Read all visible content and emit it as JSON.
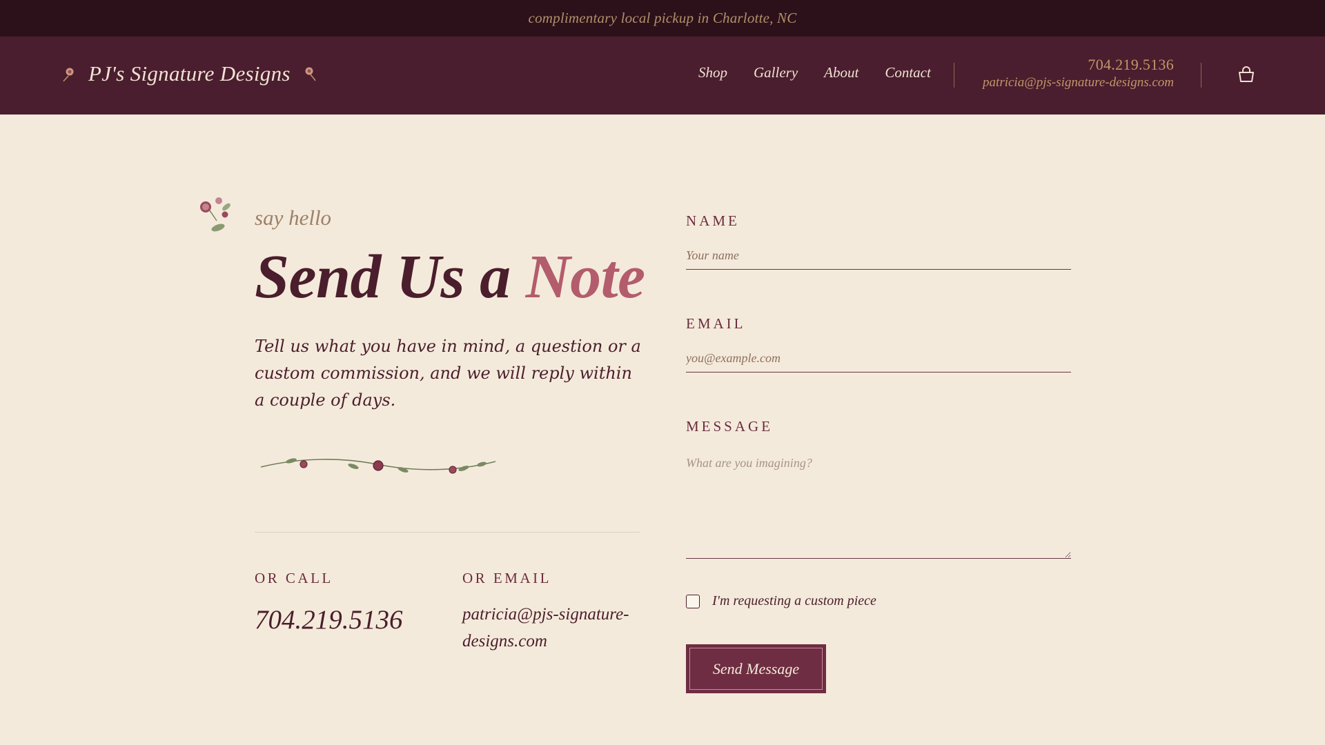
{
  "promo": {
    "text": "complimentary local pickup in Charlotte, NC"
  },
  "header": {
    "brand": "PJ's Signature Designs",
    "nav": [
      "Shop",
      "Gallery",
      "About",
      "Contact"
    ],
    "phone": "704.219.5136",
    "email": "patricia@pjs-signature-designs.com",
    "icons": [
      "flower-icon",
      "cart-icon"
    ]
  },
  "intro": {
    "eyebrow": "say hello",
    "headline_main": "Send Us a ",
    "headline_accent": "Note",
    "lede": "Tell us what you have in mind, a question or a custom commission, and we will reply within a couple of days."
  },
  "contact": {
    "call_label": "OR CALL",
    "phone": "704.219.5136",
    "email_label": "OR EMAIL",
    "email": "patricia@pjs-signature-designs.com"
  },
  "form": {
    "name_label": "NAME",
    "name_placeholder": "Your name",
    "email_label": "EMAIL",
    "email_placeholder": "you@example.com",
    "message_label": "MESSAGE",
    "message_placeholder": "What are you imagining?",
    "custom_label": "I'm requesting a custom piece",
    "custom_checked": false,
    "submit_label": "Send Message"
  },
  "colors": {
    "page_bg": "#f4eadb",
    "header_bg": "#4a1e2e",
    "promo_bg": "#2c111a",
    "wine": "#6e2d42",
    "rose_accent": "#b35c6c",
    "gold": "#c2966a",
    "leaf_green": "#7a8a62"
  }
}
